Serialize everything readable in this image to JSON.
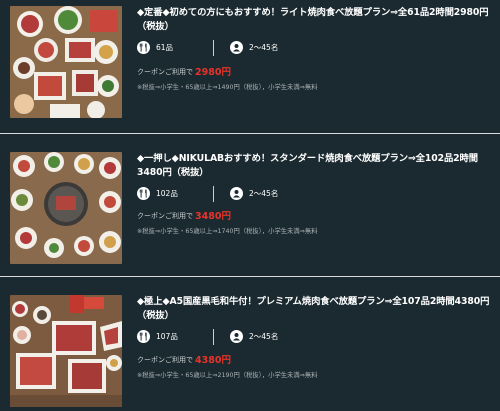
{
  "plans": [
    {
      "title": "◆定番◆初めての方にもおすすめ！ライト焼肉食べ放題プラン⇒全61品2時間2980円（税抜）",
      "count": "61品",
      "guests": "2〜45名",
      "coupon_label": "クーポンご利用で",
      "price": "2980円",
      "note": "※税抜⇒小学生・65歳以上⇒1490円（税抜），小学生未満⇒無料"
    },
    {
      "title": "◆一押し◆NIKULABおすすめ！スタンダード焼肉食べ放題プラン⇒全102品2時間3480円（税抜）",
      "count": "102品",
      "guests": "2〜45名",
      "coupon_label": "クーポンご利用で",
      "price": "3480円",
      "note": "※税抜⇒小学生・65歳以上⇒1740円（税抜），小学生未満⇒無料"
    },
    {
      "title": "◆極上◆A5国産黒毛和牛付！プレミアム焼肉食べ放題プラン⇒全107品2時間4380円（税抜）",
      "count": "107品",
      "guests": "2〜45名",
      "coupon_label": "クーポンご利用で",
      "price": "4380円",
      "note": "※税抜⇒小学生・65歳以上⇒2190円（税抜），小学生未満⇒無料"
    }
  ],
  "icons": {
    "count": "fork-knife-icon",
    "guests": "person-icon"
  },
  "colors": {
    "background": "#1b2a30",
    "price": "#e8332b",
    "title": "#ffffff",
    "note": "#a9b2b6"
  }
}
